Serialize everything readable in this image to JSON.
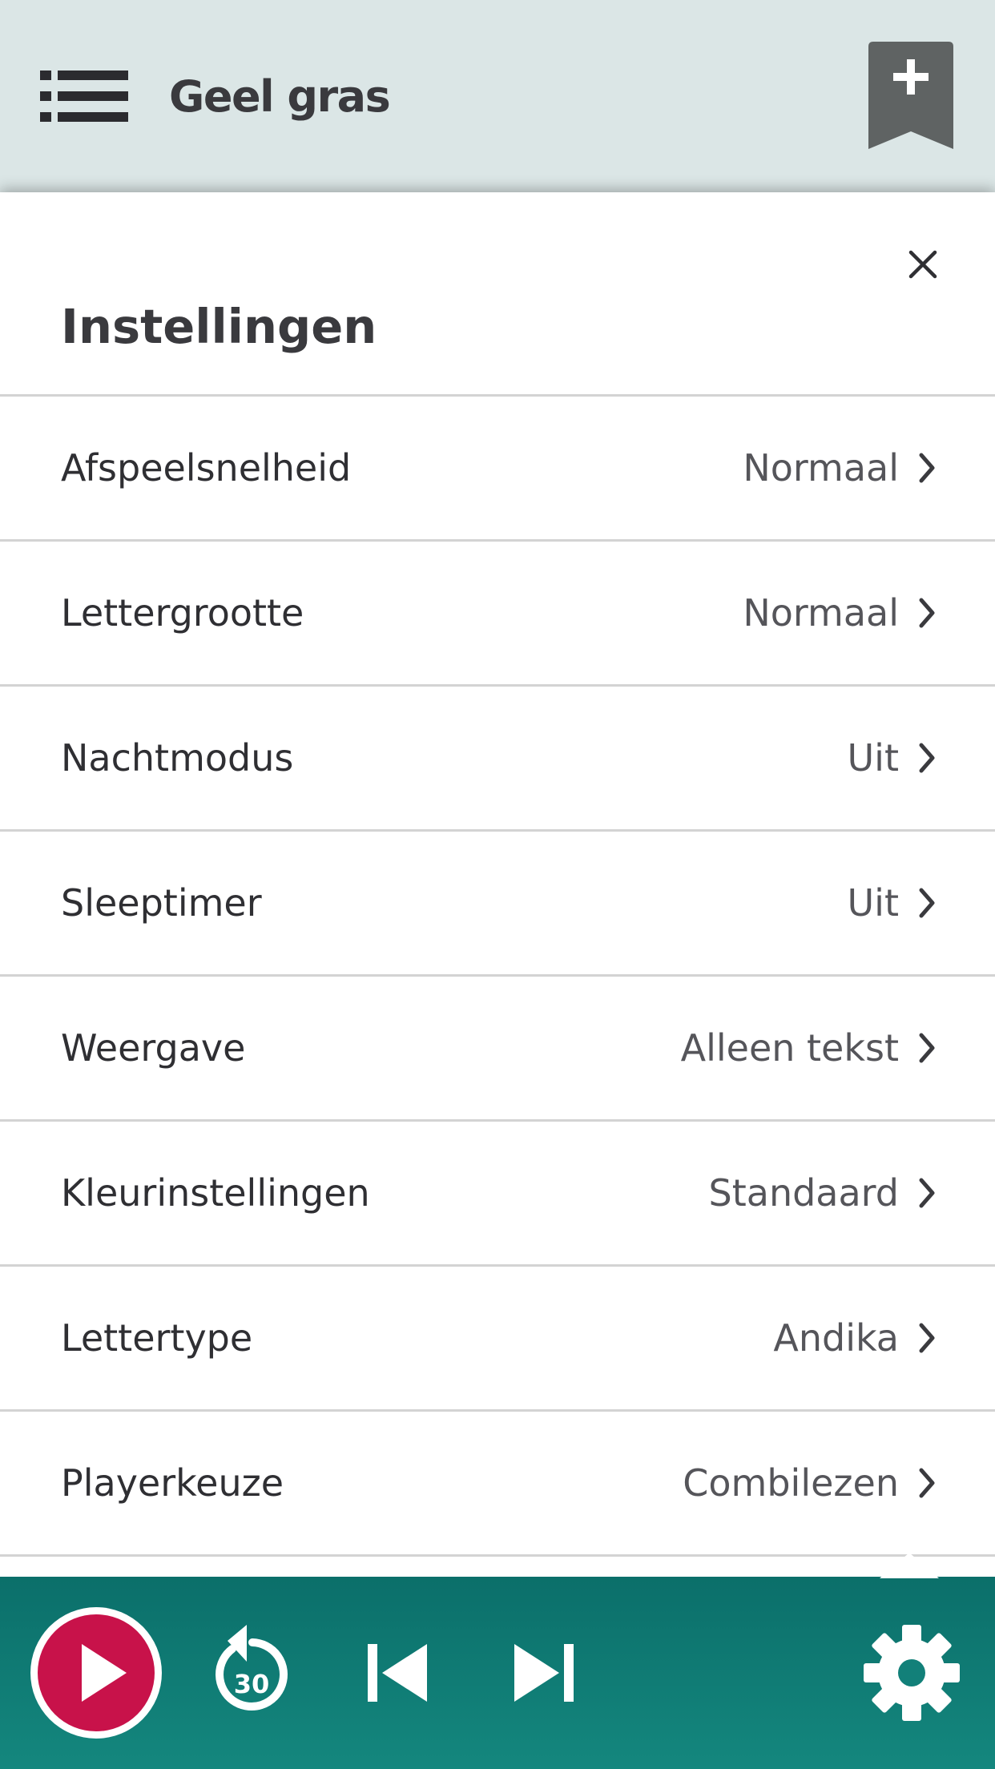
{
  "header": {
    "book_title": "Geel gras",
    "menu_icon": "list-menu-icon",
    "bookmark_icon": "bookmark-add-icon"
  },
  "settings": {
    "title": "Instellingen",
    "close_icon": "close-icon",
    "items": [
      {
        "label": "Afspeelsnelheid",
        "value": "Normaal"
      },
      {
        "label": "Lettergrootte",
        "value": "Normaal"
      },
      {
        "label": "Nachtmodus",
        "value": "Uit"
      },
      {
        "label": "Sleeptimer",
        "value": "Uit"
      },
      {
        "label": "Weergave",
        "value": "Alleen tekst"
      },
      {
        "label": "Kleurinstellingen",
        "value": "Standaard"
      },
      {
        "label": "Lettertype",
        "value": "Andika"
      },
      {
        "label": "Playerkeuze",
        "value": "Combilezen"
      }
    ]
  },
  "player": {
    "rewind_seconds": "30",
    "icons": [
      "play-icon",
      "rewind-30-icon",
      "skip-previous-icon",
      "skip-next-icon",
      "settings-gear-icon"
    ]
  },
  "colors": {
    "header_bg": "#dbe6e6",
    "player_bg": "#128079",
    "play_accent": "#c8124a",
    "bookmark": "#5f6363"
  }
}
